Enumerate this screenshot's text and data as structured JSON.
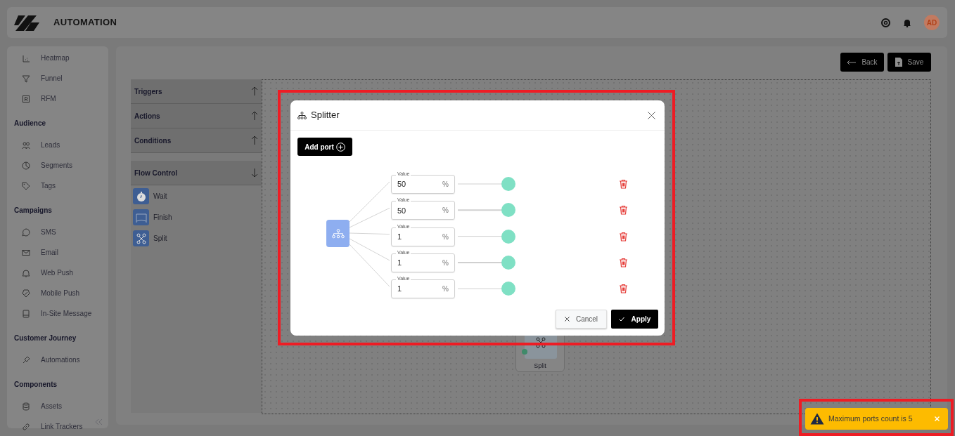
{
  "header": {
    "title": "AUTOMATION",
    "avatar": "AD"
  },
  "sidebar": {
    "sections": [
      {
        "items": [
          "Heatmap",
          "Funnel",
          "RFM"
        ]
      },
      {
        "heading": "Audience",
        "items": [
          "Leads",
          "Segments",
          "Tags"
        ]
      },
      {
        "heading": "Campaigns",
        "items": [
          "SMS",
          "Email",
          "Web Push",
          "Mobile Push",
          "In-Site Message"
        ]
      },
      {
        "heading": "Customer Journey",
        "items": [
          "Automations"
        ]
      },
      {
        "heading": "Components",
        "items": [
          "Assets",
          "Link Trackers"
        ]
      }
    ]
  },
  "toolbar": {
    "buttons": [
      "Back",
      "Save"
    ]
  },
  "palette": {
    "groups": [
      {
        "label": "Triggers",
        "expanded": false
      },
      {
        "label": "Actions",
        "expanded": false
      },
      {
        "label": "Conditions",
        "expanded": false
      },
      {
        "label": "Flow Control",
        "expanded": true,
        "items": [
          "Wait",
          "Finish",
          "Split"
        ]
      }
    ]
  },
  "canvas": {
    "node": {
      "label": "Split"
    }
  },
  "dialog": {
    "title": "Splitter",
    "add_port": "Add port",
    "ports": [
      {
        "label": "Value",
        "value": "50",
        "unit": "%"
      },
      {
        "label": "Value",
        "value": "50",
        "unit": "%"
      },
      {
        "label": "Value",
        "value": "1",
        "unit": "%"
      },
      {
        "label": "Value",
        "value": "1",
        "unit": "%"
      },
      {
        "label": "Value",
        "value": "1",
        "unit": "%"
      }
    ],
    "cancel": "Cancel",
    "apply": "Apply"
  },
  "toast": {
    "message": "Maximum ports count is 5"
  }
}
